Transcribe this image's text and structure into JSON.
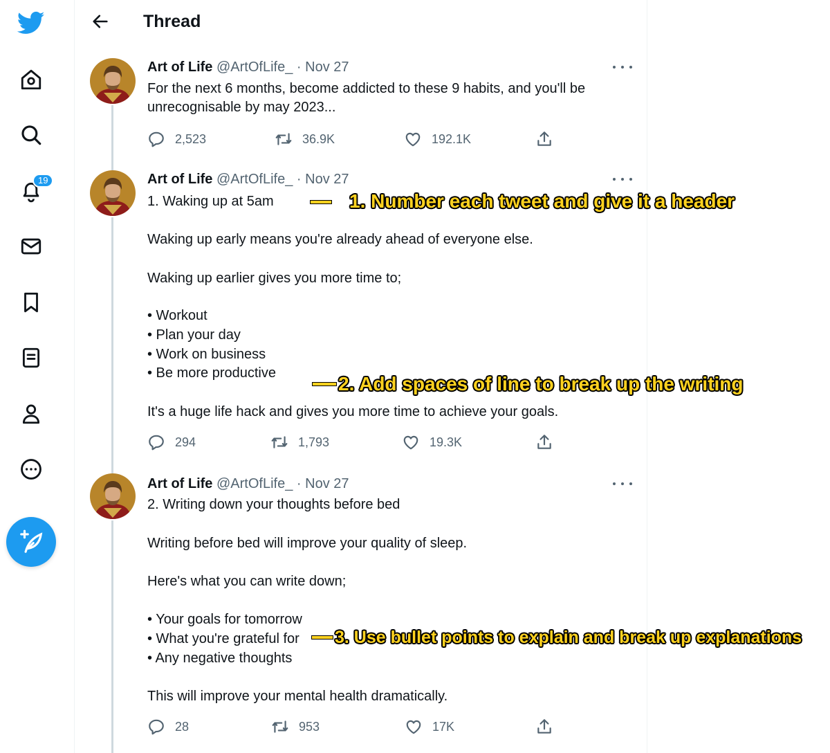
{
  "header": {
    "title": "Thread"
  },
  "sidebar": {
    "notifications_badge": "19"
  },
  "tweets": [
    {
      "name": "Art of Life",
      "handle": "@ArtOfLife_",
      "dot": "·",
      "date": "Nov 27",
      "lines": [
        "For the next 6 months, become addicted to these 9 habits, and you'll be",
        "unrecognisable by may 2023..."
      ],
      "stats": {
        "replies": "2,523",
        "retweets": "36.9K",
        "likes": "192.1K"
      }
    },
    {
      "name": "Art of Life",
      "handle": "@ArtOfLife_",
      "dot": "·",
      "date": "Nov 27",
      "lines": [
        "1. Waking up at 5am",
        "Waking up early means you're already ahead of everyone else.",
        "Waking up earlier gives you more time to;",
        "• Workout",
        "• Plan your day",
        "• Work on business",
        "• Be more productive",
        "It's a huge life hack and gives you more time to achieve your goals."
      ],
      "stats": {
        "replies": "294",
        "retweets": "1,793",
        "likes": "19.3K"
      }
    },
    {
      "name": "Art of Life",
      "handle": "@ArtOfLife_",
      "dot": "·",
      "date": "Nov 27",
      "lines": [
        "2. Writing down your thoughts before bed",
        "Writing before bed will improve your quality of sleep.",
        "Here's what you can write down;",
        "• Your goals for tomorrow",
        "• What you're grateful for",
        "• Any negative thoughts",
        "This will improve your mental health dramatically."
      ],
      "stats": {
        "replies": "28",
        "retweets": "953",
        "likes": "17K"
      }
    }
  ],
  "annotations": [
    "1. Number each tweet and give it a header",
    "2. Add spaces of line to break up the writing",
    "3. Use bullet points to explain and break up explanations"
  ],
  "colors": {
    "accent": "#1d9bf0",
    "annotation": "#ffd21f",
    "muted": "#536471"
  }
}
